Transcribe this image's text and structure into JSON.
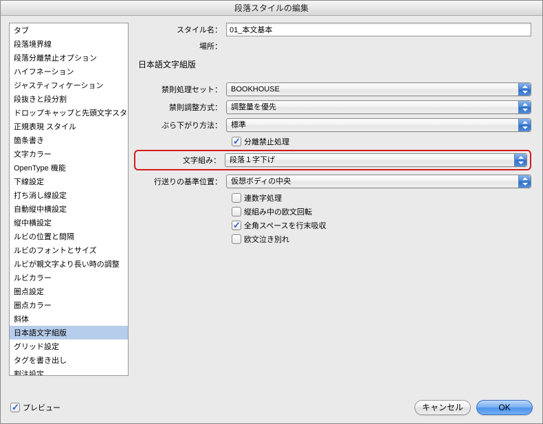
{
  "dialog": {
    "title": "段落スタイルの編集"
  },
  "header": {
    "style_name_label": "スタイル名：",
    "style_name_value": "01_本文基本",
    "location_label": "場所："
  },
  "sidebar": {
    "items": [
      "タブ",
      "段落境界線",
      "段落分離禁止オプション",
      "ハイフネーション",
      "ジャスティフィケーション",
      "段抜きと段分割",
      "ドロップキャップと先頭文字スタイル",
      "正規表現 スタイル",
      "箇条書き",
      "文字カラー",
      "OpenType 機能",
      "下線設定",
      "打ち消し線設定",
      "自動縦中横設定",
      "縦中横設定",
      "ルビの位置と間隔",
      "ルビのフォントとサイズ",
      "ルビが親文字より長い時の調整",
      "ルビカラー",
      "圏点設定",
      "圏点カラー",
      "斜体",
      "日本語文字組版",
      "グリッド設定",
      "タグを書き出し",
      "割注設定"
    ],
    "selected_index": 22
  },
  "section": {
    "title": "日本語文字組版"
  },
  "fields": {
    "kinsoku_set": {
      "label": "禁則処理セット：",
      "value": "BOOKHOUSE"
    },
    "kinsoku_adjust": {
      "label": "禁則調整方式：",
      "value": "調整量を優先"
    },
    "burasagari": {
      "label": "ぶら下がり方法：",
      "value": "標準"
    },
    "bunri_kinshi": {
      "label": "分離禁止処理",
      "checked": true
    },
    "mojikumi": {
      "label": "文字組み：",
      "value": "段落１字下げ"
    },
    "gyookuri": {
      "label": "行送りの基準位置：",
      "value": "仮想ボディの中央"
    },
    "rensuji": {
      "label": "連数字処理",
      "checked": false
    },
    "tategumi_rotate": {
      "label": "縦組み中の欧文回転",
      "checked": false
    },
    "zenkaku_space": {
      "label": "全角スペースを行末吸収",
      "checked": true
    },
    "oubun_wakare": {
      "label": "欧文泣き別れ",
      "checked": false
    }
  },
  "footer": {
    "preview_label": "プレビュー",
    "preview_checked": true,
    "cancel": "キャンセル",
    "ok": "OK"
  }
}
